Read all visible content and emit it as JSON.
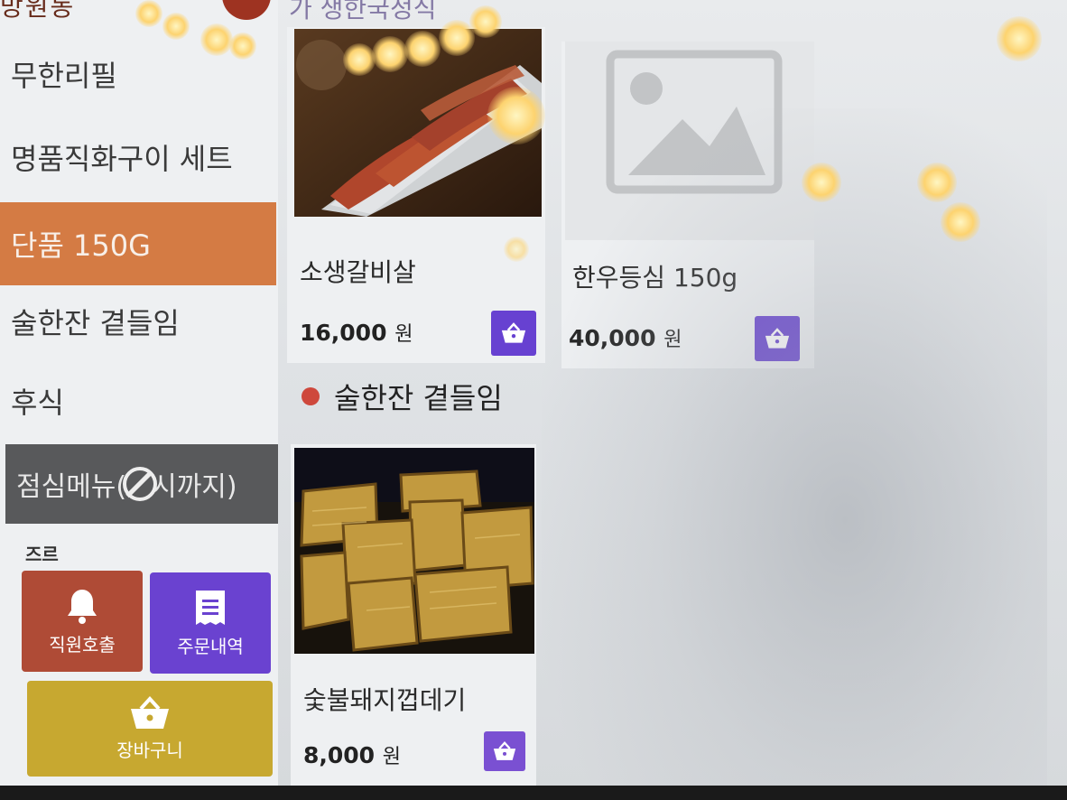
{
  "header": {
    "logo_text": "망원동",
    "category_heading": "가 생한국정식"
  },
  "sidebar": {
    "items": [
      {
        "label": "무한리필"
      },
      {
        "label": "명품직화구이 세트"
      },
      {
        "label": "단품 150G"
      },
      {
        "label": "술한잔 곁들임"
      },
      {
        "label": "후식"
      },
      {
        "label": "점심메뉴(",
        "label_tail": "시까지)",
        "icon": "no-entry-icon"
      }
    ],
    "small_label": "즈르",
    "tiles": {
      "call_staff": {
        "label": "직원호출",
        "icon": "bell-icon"
      },
      "order_history": {
        "label": "주문내역",
        "icon": "receipt-icon"
      },
      "cart": {
        "label": "장바구니",
        "icon": "basket-icon"
      }
    }
  },
  "products": [
    {
      "name": "소생갈비살",
      "price": "16,000",
      "currency": "원",
      "image": "grilled-beef-rib-photo"
    },
    {
      "name": "한우등심 150g",
      "price": "40,000",
      "currency": "원",
      "image": "placeholder-image-icon"
    }
  ],
  "section": {
    "title": "술한잔 곁들임"
  },
  "section_products": [
    {
      "name": "숯불돼지껍데기",
      "price": "8,000",
      "currency": "원",
      "image": "grilled-pork-skin-photo"
    }
  ],
  "colors": {
    "active_menu": "#d87a40",
    "disabled_menu": "#58595b",
    "call_staff_tile": "#b34a34",
    "order_history_tile": "#6b41d6",
    "cart_tile": "#c9a82a",
    "cart_button": "#6840d8",
    "section_dot": "#d4473a"
  }
}
